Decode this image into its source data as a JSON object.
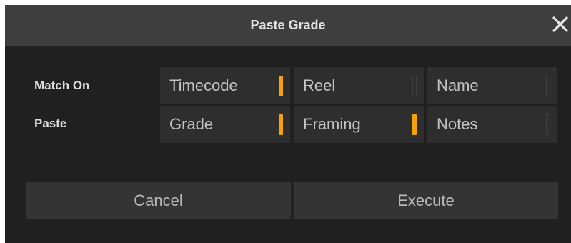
{
  "dialog": {
    "title": "Paste Grade",
    "close_icon": "close-icon"
  },
  "colors": {
    "accent": "#f5a20b",
    "titlebar": "#3e3e3e",
    "background": "#202020",
    "cell": "#2e2e2e",
    "button": "#343434"
  },
  "match_on": {
    "label": "Match On",
    "options": [
      {
        "label": "Timecode",
        "checked": true
      },
      {
        "label": "Reel",
        "checked": false
      },
      {
        "label": "Name",
        "checked": false
      }
    ]
  },
  "paste": {
    "label": "Paste",
    "options": [
      {
        "label": "Grade",
        "checked": true
      },
      {
        "label": "Framing",
        "checked": true
      },
      {
        "label": "Notes",
        "checked": false
      }
    ]
  },
  "buttons": {
    "cancel": "Cancel",
    "execute": "Execute"
  }
}
